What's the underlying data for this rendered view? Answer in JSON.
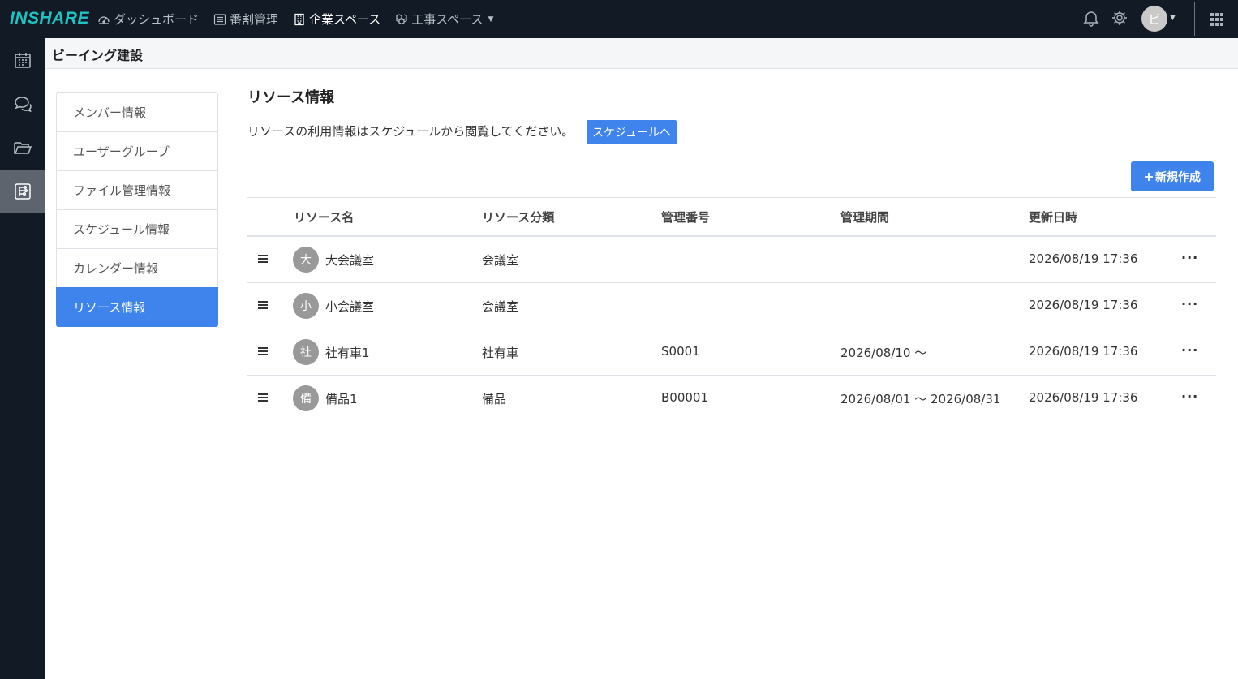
{
  "topbar": {
    "logo": "INSHARE",
    "nav": [
      {
        "label": "ダッシュボード",
        "icon": "speedometer-icon",
        "active": false
      },
      {
        "label": "番割管理",
        "icon": "list-icon",
        "active": false
      },
      {
        "label": "企業スペース",
        "icon": "building-icon",
        "active": true
      },
      {
        "label": "工事スペース",
        "icon": "boxes-icon",
        "active": false
      }
    ],
    "user_initial": "ビ"
  },
  "sidebar": {
    "items": [
      {
        "icon": "calendar-icon",
        "active": false
      },
      {
        "icon": "chat-icon",
        "active": false
      },
      {
        "icon": "folder-icon",
        "active": false
      },
      {
        "icon": "resource-icon",
        "active": true
      }
    ]
  },
  "header": {
    "company": "ビーイング建設"
  },
  "submenu": {
    "items": [
      {
        "label": "メンバー情報"
      },
      {
        "label": "ユーザーグループ"
      },
      {
        "label": "ファイル管理情報"
      },
      {
        "label": "スケジュール情報"
      },
      {
        "label": "カレンダー情報"
      },
      {
        "label": "リソース情報"
      }
    ]
  },
  "main": {
    "title": "リソース情報",
    "info": "リソースの利用情報はスケジュールから閲覧してください。",
    "schedule_button": "スケジュールへ",
    "new_button": "新規作成",
    "columns": [
      "リソース名",
      "リソース分類",
      "管理番号",
      "管理期間",
      "更新日時"
    ],
    "rows": [
      {
        "initial": "大",
        "name": "大会議室",
        "category": "会議室",
        "number": "",
        "period": "",
        "updated": "2026/08/19 17:36"
      },
      {
        "initial": "小",
        "name": "小会議室",
        "category": "会議室",
        "number": "",
        "period": "",
        "updated": "2026/08/19 17:36"
      },
      {
        "initial": "社",
        "name": "社有車1",
        "category": "社有車",
        "number": "S0001",
        "period": "2026/08/10 ～",
        "updated": "2026/08/19 17:36"
      },
      {
        "initial": "備",
        "name": "備品1",
        "category": "備品",
        "number": "B00001",
        "period": "2026/08/01 ～ 2026/08/31",
        "updated": "2026/08/19 17:36"
      }
    ],
    "more_label": "···"
  },
  "colors": {
    "accent": "#3f83ec",
    "nav_bg": "#111a25",
    "logo": "#1ec3c3"
  }
}
